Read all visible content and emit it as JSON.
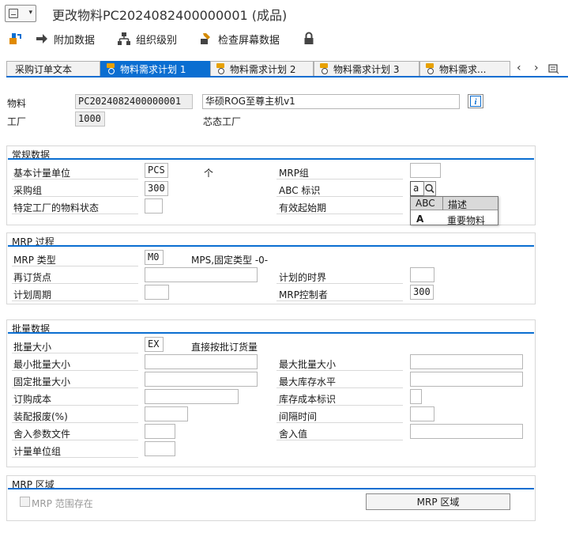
{
  "window": {
    "title": "更改物料PC2024082400000001 (成品)"
  },
  "toolbar": {
    "items": [
      {
        "label": "",
        "icon": "switch-view-icon"
      },
      {
        "label": "附加数据",
        "icon": "arrow-right-icon"
      },
      {
        "label": "组织级别",
        "icon": "org-hierarchy-icon"
      },
      {
        "label": "检查屏幕数据",
        "icon": "check-screen-icon"
      },
      {
        "label": "",
        "icon": "lock-icon"
      }
    ]
  },
  "tabs": [
    {
      "label": "采购订单文本",
      "active": false
    },
    {
      "label": "物料需求计划 1",
      "active": true
    },
    {
      "label": "物料需求计划 2",
      "active": false
    },
    {
      "label": "物料需求计划 3",
      "active": false
    },
    {
      "label": "物料需求...",
      "active": false
    }
  ],
  "header": {
    "material_label": "物料",
    "material_value": "PC2024082400000001",
    "material_desc": "华硕ROG至尊主机v1",
    "plant_label": "工厂",
    "plant_value": "1000",
    "plant_desc": "芯态工厂"
  },
  "general": {
    "title": "常规数据",
    "base_uom_label": "基本计量单位",
    "base_uom_value": "PCS",
    "base_uom_desc": "个",
    "mrp_group_label": "MRP组",
    "mrp_group_value": "",
    "purch_group_label": "采购组",
    "purch_group_value": "300",
    "abc_label": "ABC 标识",
    "abc_value": "a",
    "plant_status_label": "特定工厂的物料状态",
    "plant_status_value": "",
    "valid_from_label": "有效起始期",
    "valid_from_value": ""
  },
  "abc_popup": {
    "col1": "ABC",
    "col2": "描述",
    "row_code": "A",
    "row_desc": "重要物料"
  },
  "mrp_process": {
    "title": "MRP 过程",
    "mrp_type_label": "MRP 类型",
    "mrp_type_value": "M0",
    "mrp_type_desc": "MPS,固定类型 -0-",
    "reorder_label": "再订货点",
    "reorder_value": "",
    "plan_fence_label": "计划的时界",
    "plan_fence_value": "",
    "plan_cycle_label": "计划周期",
    "plan_cycle_value": "",
    "controller_label": "MRP控制者",
    "controller_value": "300"
  },
  "lot_data": {
    "title": "批量数据",
    "lot_size_label": "批量大小",
    "lot_size_value": "EX",
    "lot_size_desc": "直接按批订货量",
    "min_lot_label": "最小批量大小",
    "max_lot_label": "最大批量大小",
    "fixed_lot_label": "固定批量大小",
    "max_stock_label": "最大库存水平",
    "order_cost_label": "订购成本",
    "storage_cost_label": "库存成本标识",
    "assembly_scrap_label": "装配报废(%)",
    "takt_time_label": "间隔时间",
    "rounding_profile_label": "舍入参数文件",
    "rounding_value_label": "舍入值",
    "uom_group_label": "计量单位组"
  },
  "mrp_areas": {
    "title": "MRP 区域",
    "checkbox_label": "MRP  范围存在",
    "button_label": "MRP 区域"
  },
  "colors": {
    "accent": "#0a6ed1",
    "border": "#b6b6b6"
  }
}
